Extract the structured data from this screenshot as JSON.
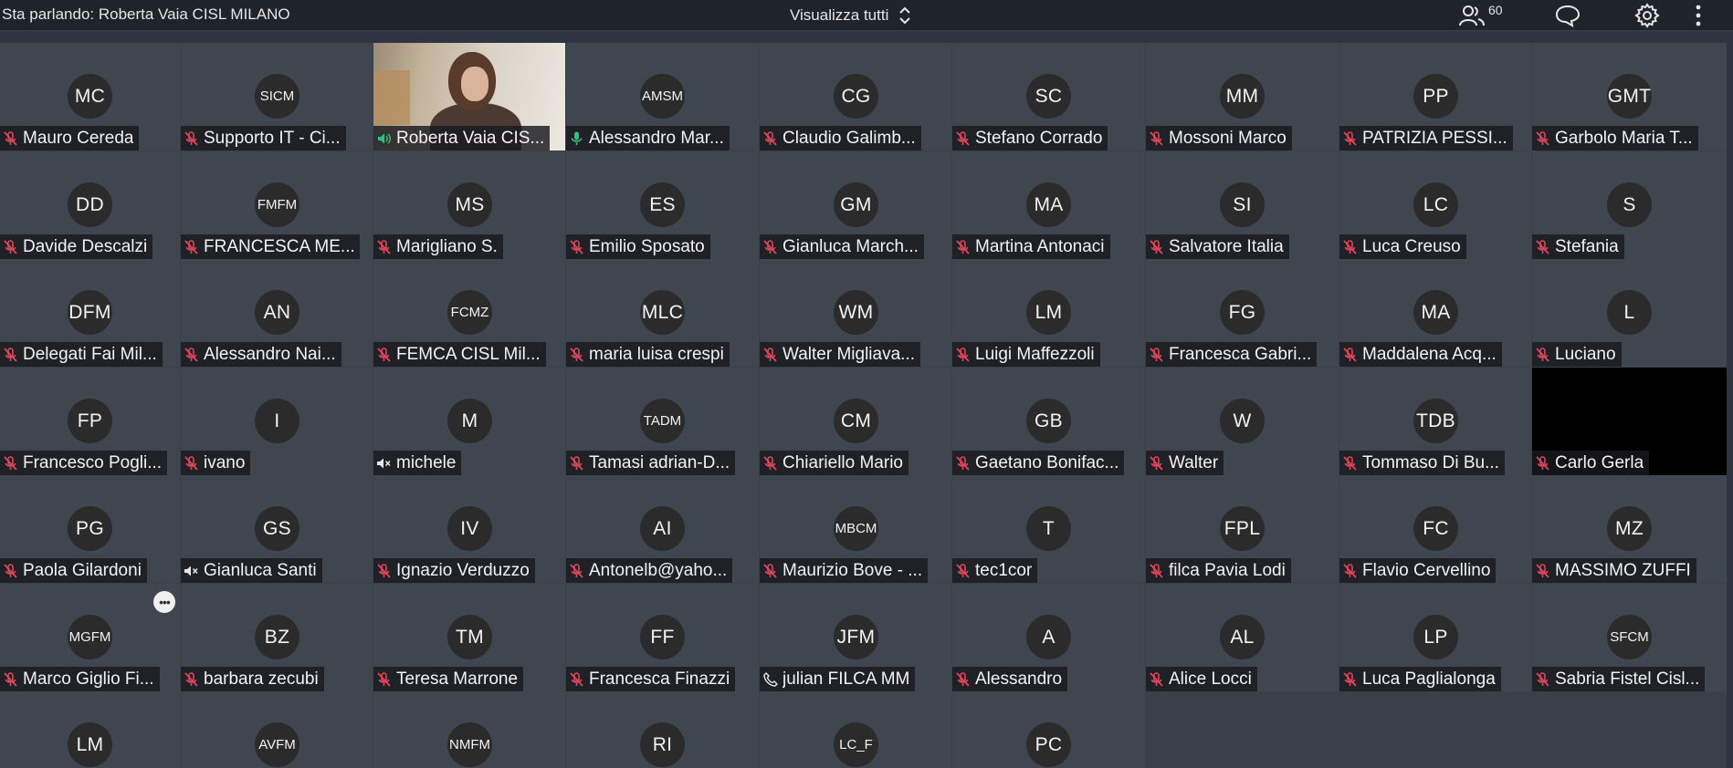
{
  "topbar": {
    "speaking_label": "Sta parlando: Roberta Vaia CISL MILANO",
    "view_all_label": "Visualizza tutti",
    "participants_count": "60"
  },
  "tiles": [
    [
      {
        "initials": "MC",
        "name": "Mauro Cereda",
        "status": "muted"
      },
      {
        "initials": "SICM",
        "name": "Supporto IT - Ci...",
        "status": "muted"
      },
      {
        "initials": "",
        "name": "Roberta Vaia CIS...",
        "status": "speaking",
        "video": true
      },
      {
        "initials": "AMSM",
        "name": "Alessandro Mar...",
        "status": "mic-on"
      },
      {
        "initials": "CG",
        "name": "Claudio Galimb...",
        "status": "muted"
      },
      {
        "initials": "SC",
        "name": "Stefano Corrado",
        "status": "muted"
      },
      {
        "initials": "MM",
        "name": "Mossoni Marco",
        "status": "muted"
      },
      {
        "initials": "PP",
        "name": "PATRIZIA PESSI...",
        "status": "muted"
      },
      {
        "initials": "GMT",
        "name": "Garbolo Maria T...",
        "status": "muted"
      }
    ],
    [
      {
        "initials": "DD",
        "name": "Davide Descalzi",
        "status": "muted"
      },
      {
        "initials": "FMFM",
        "name": "FRANCESCA ME...",
        "status": "muted"
      },
      {
        "initials": "MS",
        "name": "Marigliano S.",
        "status": "muted"
      },
      {
        "initials": "ES",
        "name": "Emilio Sposato",
        "status": "muted"
      },
      {
        "initials": "GM",
        "name": "Gianluca March...",
        "status": "muted"
      },
      {
        "initials": "MA",
        "name": "Martina Antonaci",
        "status": "muted"
      },
      {
        "initials": "SI",
        "name": "Salvatore Italia",
        "status": "muted"
      },
      {
        "initials": "LC",
        "name": "Luca Creuso",
        "status": "muted"
      },
      {
        "initials": "S",
        "name": "Stefania",
        "status": "muted"
      }
    ],
    [
      {
        "initials": "DFM",
        "name": "Delegati Fai Mil...",
        "status": "muted"
      },
      {
        "initials": "AN",
        "name": "Alessandro Nai...",
        "status": "muted"
      },
      {
        "initials": "FCMZ",
        "name": "FEMCA CISL Mil...",
        "status": "muted"
      },
      {
        "initials": "MLC",
        "name": "maria luisa crespi",
        "status": "muted"
      },
      {
        "initials": "WM",
        "name": "Walter Migliava...",
        "status": "muted"
      },
      {
        "initials": "LM",
        "name": "Luigi Maffezzoli",
        "status": "muted"
      },
      {
        "initials": "FG",
        "name": "Francesca Gabri...",
        "status": "muted"
      },
      {
        "initials": "MA",
        "name": "Maddalena Acq...",
        "status": "muted"
      },
      {
        "initials": "L",
        "name": "Luciano",
        "status": "muted"
      }
    ],
    [
      {
        "initials": "FP",
        "name": "Francesco Pogli...",
        "status": "muted"
      },
      {
        "initials": "I",
        "name": "ivano",
        "status": "muted"
      },
      {
        "initials": "M",
        "name": "michele",
        "status": "speaker-off"
      },
      {
        "initials": "TADM",
        "name": "Tamasi adrian-D...",
        "status": "muted"
      },
      {
        "initials": "CM",
        "name": "Chiariello Mario",
        "status": "muted"
      },
      {
        "initials": "GB",
        "name": "Gaetano Bonifac...",
        "status": "muted"
      },
      {
        "initials": "W",
        "name": "Walter",
        "status": "muted"
      },
      {
        "initials": "TDB",
        "name": "Tommaso Di Bu...",
        "status": "muted"
      },
      {
        "initials": "",
        "name": "Carlo Gerla",
        "status": "muted",
        "black": true
      }
    ],
    [
      {
        "initials": "PG",
        "name": "Paola Gilardoni",
        "status": "muted"
      },
      {
        "initials": "GS",
        "name": "Gianluca Santi",
        "status": "speaker-off"
      },
      {
        "initials": "IV",
        "name": "Ignazio Verduzzo",
        "status": "muted"
      },
      {
        "initials": "AI",
        "name": "Antonelb@yaho...",
        "status": "muted"
      },
      {
        "initials": "MBCM",
        "name": "Maurizio Bove - ...",
        "status": "muted"
      },
      {
        "initials": "T",
        "name": "tec1cor",
        "status": "muted"
      },
      {
        "initials": "FPL",
        "name": "filca Pavia Lodi",
        "status": "muted"
      },
      {
        "initials": "FC",
        "name": "Flavio Cervellino",
        "status": "muted"
      },
      {
        "initials": "MZ",
        "name": "MASSIMO ZUFFI",
        "status": "muted"
      }
    ],
    [
      {
        "initials": "MGFM",
        "name": "Marco Giglio Fi...",
        "status": "muted"
      },
      {
        "initials": "BZ",
        "name": "barbara zecubi",
        "status": "muted"
      },
      {
        "initials": "TM",
        "name": "Teresa Marrone",
        "status": "muted"
      },
      {
        "initials": "FF",
        "name": "Francesca Finazzi",
        "status": "muted"
      },
      {
        "initials": "JFM",
        "name": "julian FILCA MM",
        "status": "phone"
      },
      {
        "initials": "A",
        "name": "Alessandro",
        "status": "muted"
      },
      {
        "initials": "AL",
        "name": "Alice Locci",
        "status": "muted"
      },
      {
        "initials": "LP",
        "name": "Luca Paglialonga",
        "status": "muted"
      },
      {
        "initials": "SFCM",
        "name": "Sabria Fistel Cisl...",
        "status": "muted"
      }
    ],
    [
      {
        "initials": "LM",
        "name": "",
        "status": "none"
      },
      {
        "initials": "AVFM",
        "name": "",
        "status": "none"
      },
      {
        "initials": "NMFM",
        "name": "",
        "status": "none"
      },
      {
        "initials": "RI",
        "name": "",
        "status": "none"
      },
      {
        "initials": "LC_F",
        "name": "",
        "status": "none"
      },
      {
        "initials": "PC",
        "name": "",
        "status": "none"
      }
    ]
  ],
  "colors": {
    "muted_icon": "#e0455a",
    "mic_on_icon": "#2ec27e",
    "speaking_icon": "#2ec27e",
    "neutral_icon": "#e6e6e6"
  },
  "icons": {
    "participants": "people-icon",
    "chat": "chat-bubble-icon",
    "settings": "gear-icon",
    "more": "more-vertical-icon",
    "view_toggle": "chevron-updown-icon",
    "tile_more": "more-horizontal-icon"
  }
}
